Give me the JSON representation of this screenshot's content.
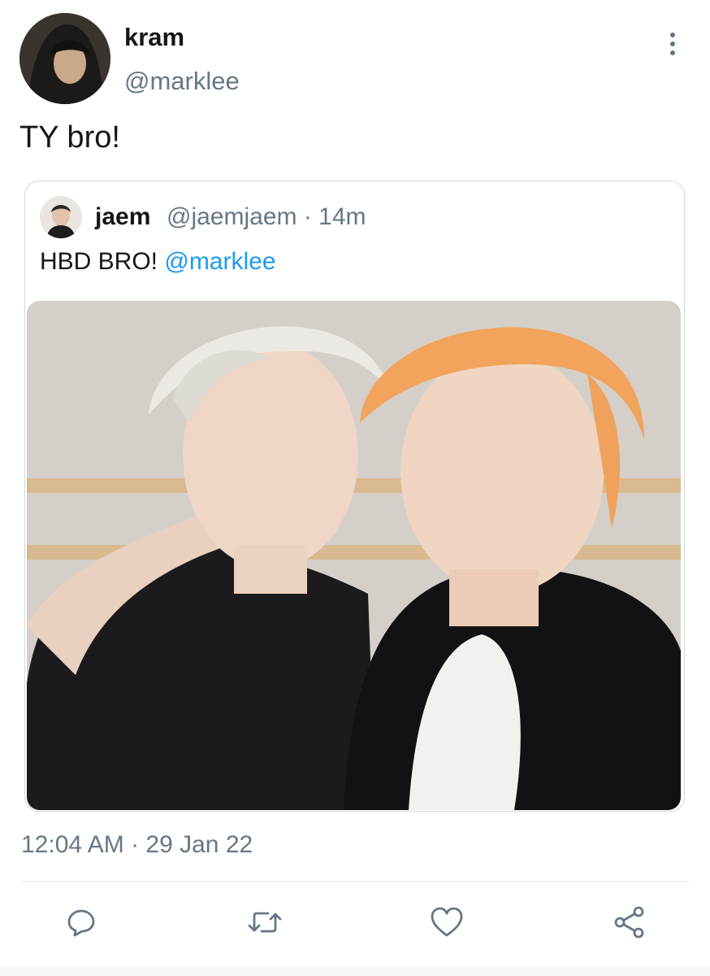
{
  "author": {
    "display_name": "kram",
    "handle": "@marklee",
    "avatar_icon": "user-avatar"
  },
  "tweet": {
    "text": "TY bro!"
  },
  "quoted_tweet": {
    "display_name": "jaem",
    "handle": "@jaemjaem · 14m",
    "text_prefix": "HBD BRO! ",
    "mention": "@marklee",
    "photo_icon": "photo"
  },
  "timestamp": "12:04 AM · 29 Jan 22",
  "actions": [
    "reply-icon",
    "retweet-icon",
    "like-icon",
    "share-icon"
  ],
  "colors": {
    "link": "#1d9bf0",
    "secondary_text": "#657786",
    "border": "#cfd9de"
  }
}
